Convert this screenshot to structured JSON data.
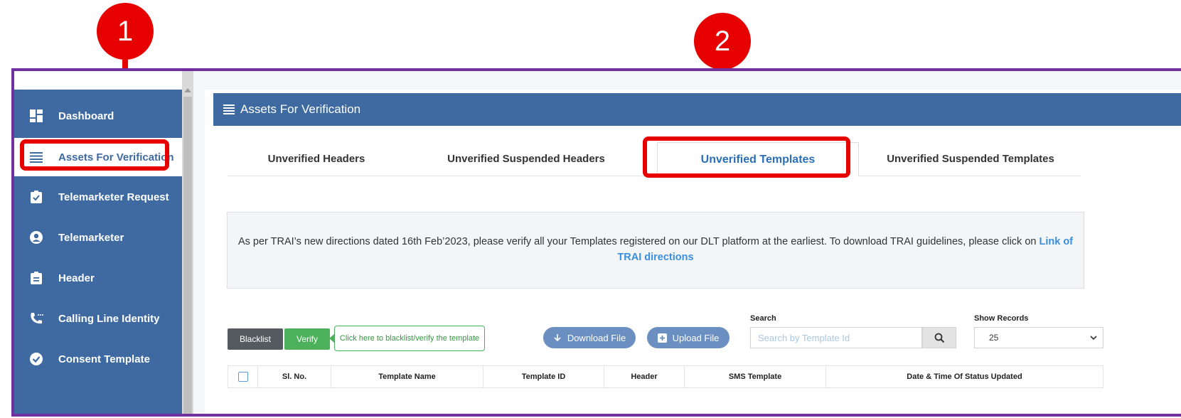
{
  "annotations": {
    "marker1": "1",
    "marker2": "2"
  },
  "sidebar": {
    "items": [
      {
        "label": "Dashboard",
        "icon": "dashboard-icon"
      },
      {
        "label": "Assets For Verification",
        "icon": "list-icon"
      },
      {
        "label": "Telemarketer Request",
        "icon": "clipboard-check-icon"
      },
      {
        "label": "Telemarketer",
        "icon": "user-circle-icon"
      },
      {
        "label": "Header",
        "icon": "clipboard-icon"
      },
      {
        "label": "Calling Line Identity",
        "icon": "phone-icon"
      },
      {
        "label": "Consent Template",
        "icon": "check-circle-icon"
      }
    ]
  },
  "card": {
    "title": "Assets For Verification"
  },
  "tabs": [
    {
      "label": "Unverified Headers"
    },
    {
      "label": "Unverified Suspended Headers"
    },
    {
      "label": "Unverified Templates"
    },
    {
      "label": "Unverified Suspended Templates"
    }
  ],
  "notice": {
    "text": "As per TRAI’s new directions dated 16th Feb’2023, please verify all your Templates registered on our DLT platform at the earliest. To download TRAI guidelines, please click on ",
    "link": "Link of TRAI directions"
  },
  "toolbar": {
    "blacklist_label": "Blacklist",
    "verify_label": "Verify",
    "hint": "Click here to blacklist/verify the template",
    "download_label": "Download File",
    "upload_label": "Upload File",
    "search_label": "Search",
    "search_placeholder": "Search by Template Id",
    "show_records_label": "Show Records",
    "show_records_value": "25"
  },
  "table": {
    "columns": [
      "Sl. No.",
      "Template Name",
      "Template ID",
      "Header",
      "SMS Template",
      "Date & Time Of Status Updated"
    ]
  },
  "colors": {
    "brand": "#3e6aa1",
    "annotation": "#e60000",
    "frame": "#7030a0",
    "verify": "#4db05a"
  }
}
